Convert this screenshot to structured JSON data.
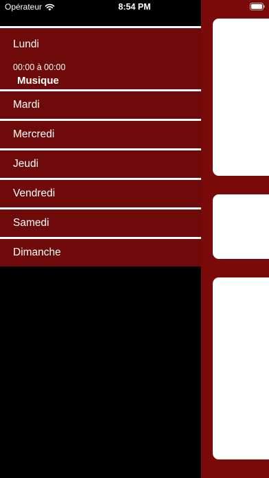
{
  "status_bar": {
    "carrier": "Opérateur",
    "time": "8:54 PM"
  },
  "menu": {
    "days": [
      {
        "label": "Lundi",
        "schedule": [
          {
            "time": "00:00 à 00:00",
            "title": "Musique"
          }
        ]
      },
      {
        "label": "Mardi"
      },
      {
        "label": "Mercredi"
      },
      {
        "label": "Jeudi"
      },
      {
        "label": "Vendredi"
      },
      {
        "label": "Samedi"
      },
      {
        "label": "Dimanche"
      }
    ]
  },
  "colors": {
    "menu_row": "#6e0a0a",
    "panel": "#7a0a0a",
    "divider": "#ffffff",
    "background": "#000000"
  }
}
